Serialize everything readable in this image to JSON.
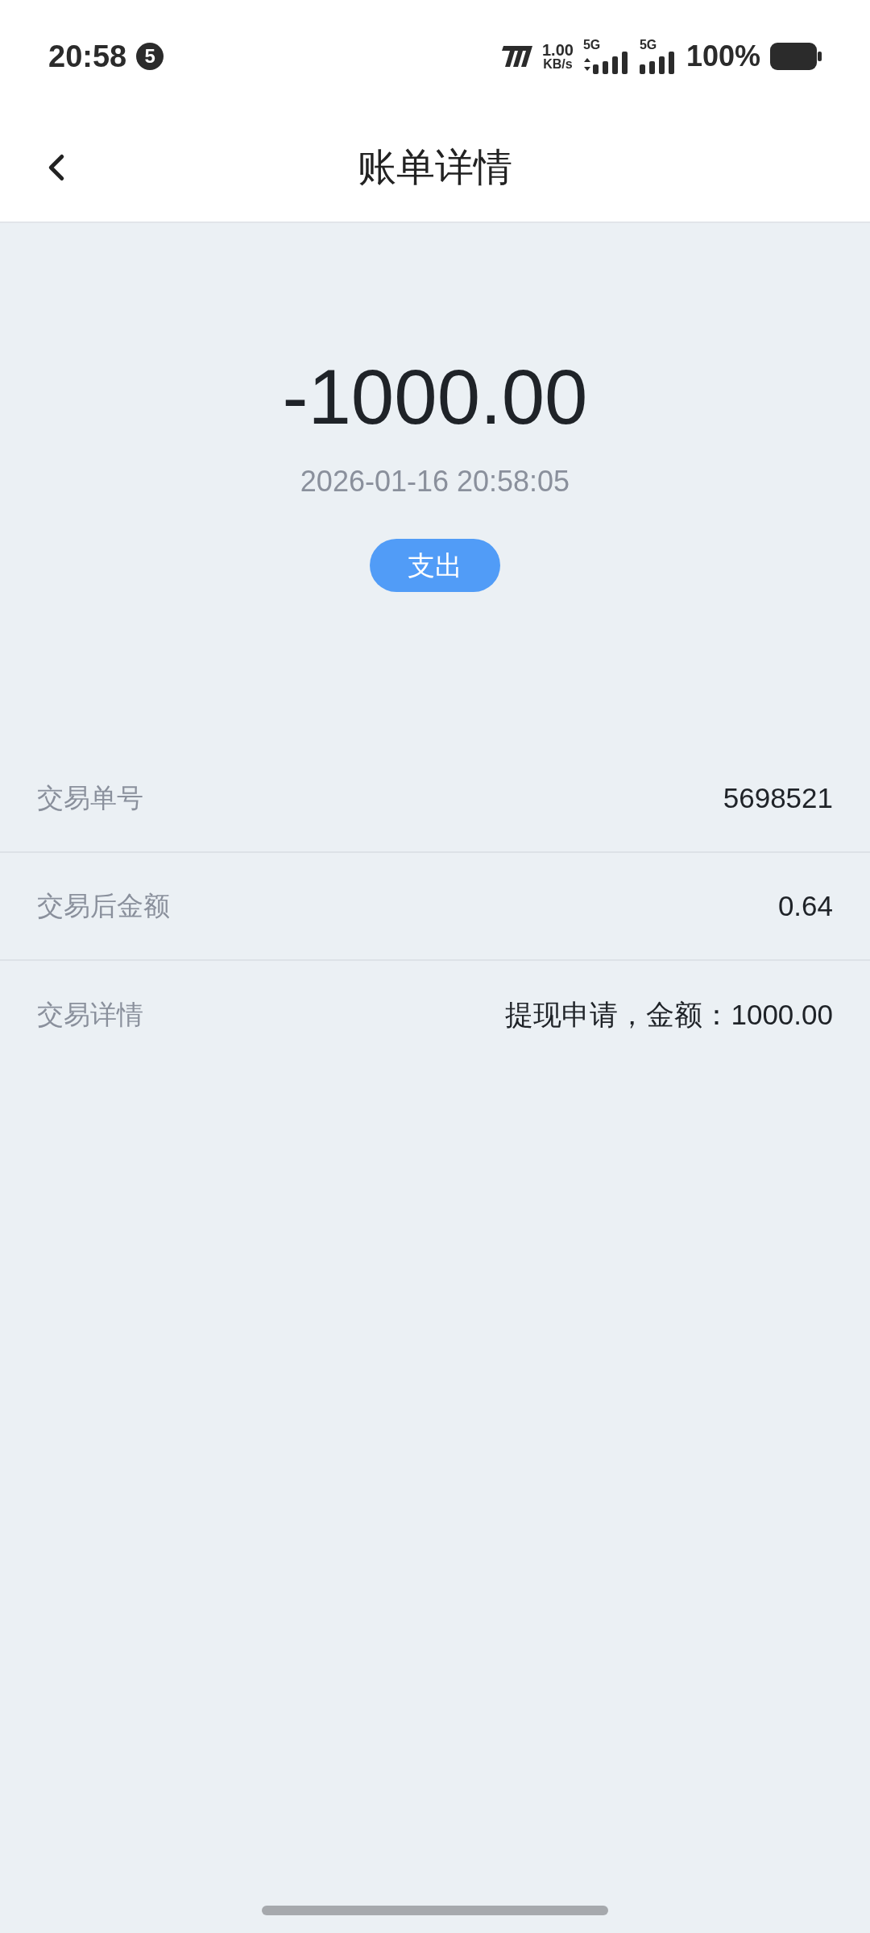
{
  "status_bar": {
    "time": "20:58",
    "notification_count": "5",
    "net_speed": "1.00",
    "net_speed_unit": "KB/s",
    "sim_1": "5G",
    "sim_2": "5G",
    "battery": "100%"
  },
  "header": {
    "title": "账单详情"
  },
  "summary": {
    "amount": "-1000.00",
    "datetime": "2026-01-16 20:58:05",
    "type_badge": "支出"
  },
  "details": [
    {
      "label": "交易单号",
      "value": "5698521"
    },
    {
      "label": "交易后金额",
      "value": "0.64"
    },
    {
      "label": "交易详情",
      "value": "提现申请，金额：1000.00"
    }
  ]
}
